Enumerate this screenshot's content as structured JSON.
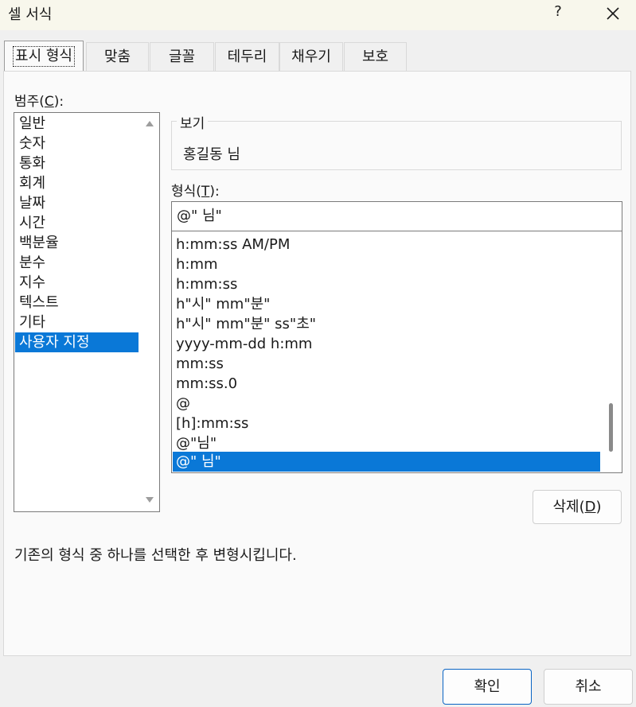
{
  "window": {
    "title": "셀 서식",
    "help_label": "?"
  },
  "tabs": [
    {
      "label": "표시 형식"
    },
    {
      "label": "맞춤"
    },
    {
      "label": "글꼴"
    },
    {
      "label": "테두리"
    },
    {
      "label": "채우기"
    },
    {
      "label": "보호"
    }
  ],
  "category": {
    "label_main": "범주(",
    "label_key": "C",
    "label_end": "):",
    "items": [
      "일반",
      "숫자",
      "통화",
      "회계",
      "날짜",
      "시간",
      "백분율",
      "분수",
      "지수",
      "텍스트",
      "기타",
      "사용자 지정"
    ],
    "selected_index": 11
  },
  "preview": {
    "legend": "보기",
    "value": "홍길동 님"
  },
  "format": {
    "label_main": "형식(",
    "label_key": "T",
    "label_end": "):",
    "input_value": "@\" 님\"",
    "items": [
      "h:mm:ss AM/PM",
      "h:mm",
      "h:mm:ss",
      "h\"시\" mm\"분\"",
      "h\"시\" mm\"분\" ss\"초\"",
      "yyyy-mm-dd h:mm",
      "mm:ss",
      "mm:ss.0",
      "@",
      "[h]:mm:ss",
      "@\"님\"",
      "@\" 님\""
    ],
    "selected_index": 11
  },
  "buttons": {
    "delete_main": "삭제(",
    "delete_key": "D",
    "delete_end": ")",
    "ok": "확인",
    "cancel": "취소"
  },
  "description": "기존의 형식 중 하나를 선택한 후 변형시킵니다.",
  "colors": {
    "selection": "#0a78d7",
    "title_bar": "#f8f7ec"
  }
}
